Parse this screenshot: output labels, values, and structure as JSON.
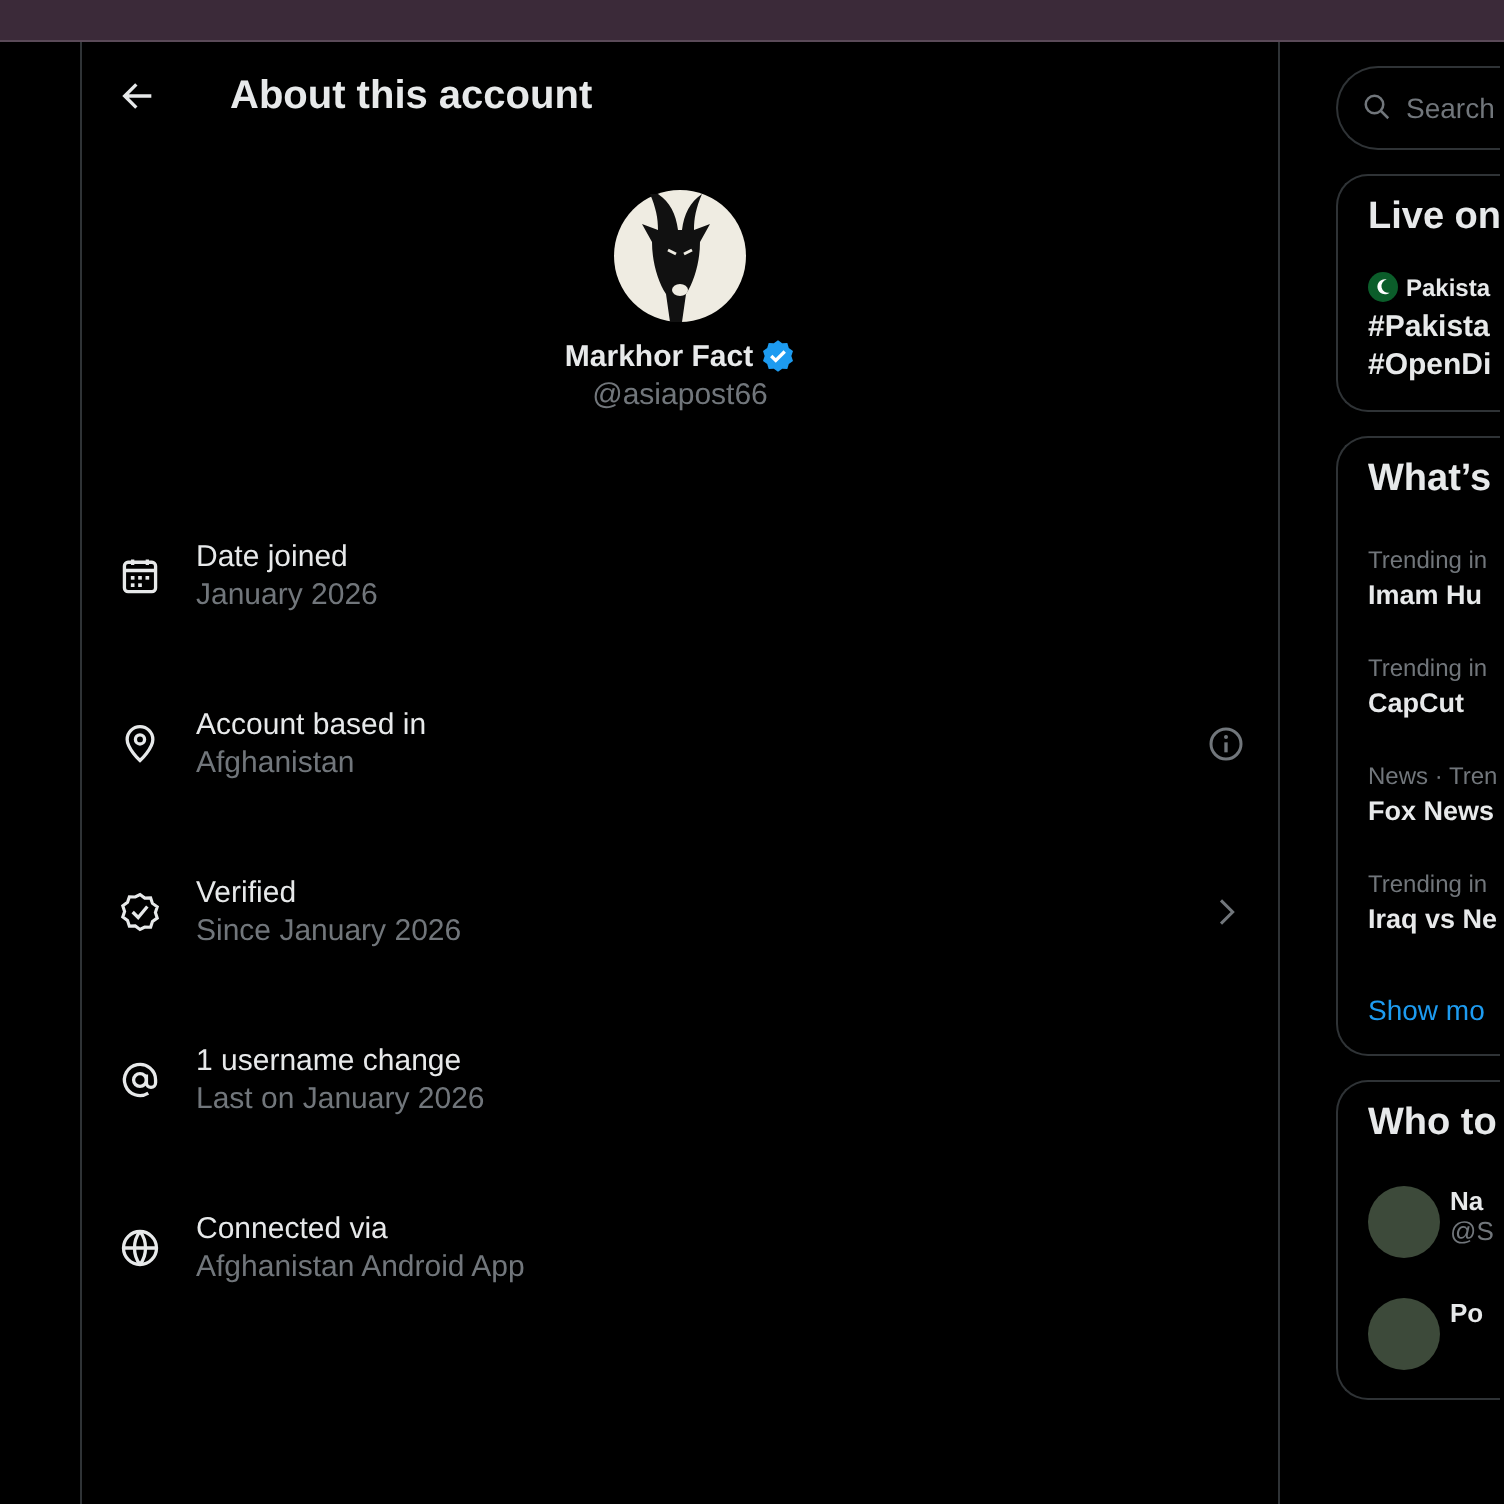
{
  "header": {
    "title": "About this account"
  },
  "profile": {
    "name": "Markhor Fact",
    "handle": "@asiapost66",
    "verified": true
  },
  "details": [
    {
      "kind": "calendar",
      "label": "Date joined",
      "value": "January 2026",
      "info": false,
      "chevron": false
    },
    {
      "kind": "location",
      "label": "Account based in",
      "value": "Afghanistan",
      "info": true,
      "chevron": false
    },
    {
      "kind": "verified",
      "label": "Verified",
      "value": "Since January 2026",
      "info": false,
      "chevron": true
    },
    {
      "kind": "at",
      "label": "1 username change",
      "value": "Last on January 2026",
      "info": false,
      "chevron": false
    },
    {
      "kind": "globe",
      "label": "Connected via",
      "value": "Afghanistan Android App",
      "info": false,
      "chevron": false
    }
  ],
  "sidebar": {
    "search": {
      "placeholder": "Search"
    },
    "live": {
      "title": "Live on",
      "source": "Pakista",
      "lines": [
        "#Pakista",
        "#OpenDi"
      ]
    },
    "trends": {
      "title": "What’s",
      "items": [
        {
          "meta": "Trending in",
          "name": "Imam Hu"
        },
        {
          "meta": "Trending in",
          "name": "CapCut"
        },
        {
          "meta": "News · Tren",
          "name": "Fox News"
        },
        {
          "meta": "Trending in",
          "name": "Iraq vs Ne"
        }
      ],
      "show_more": "Show mo"
    },
    "who": {
      "title": "Who to",
      "users": [
        {
          "name": "Na",
          "handle": "@S"
        },
        {
          "name": "Po"
        }
      ]
    }
  }
}
